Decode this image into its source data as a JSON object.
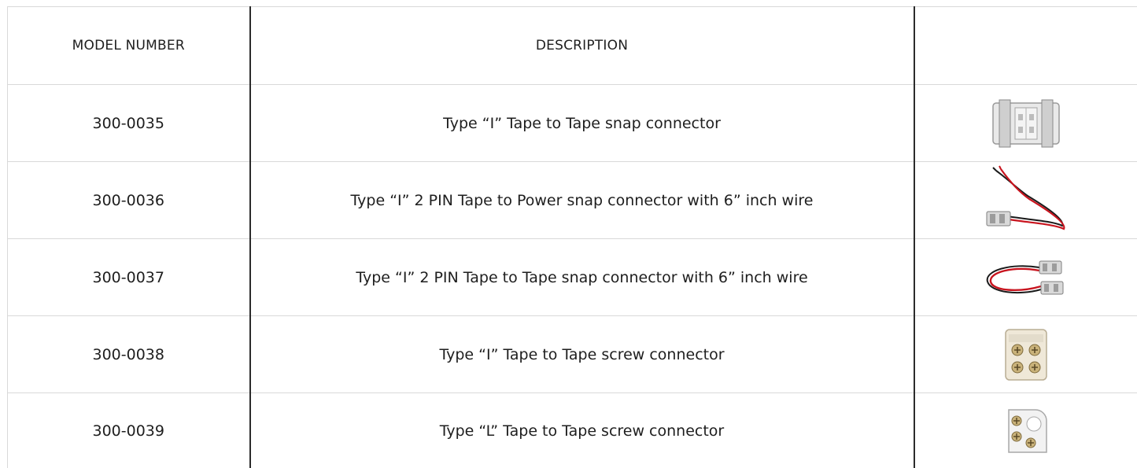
{
  "table": {
    "headers": {
      "model": "MODEL NUMBER",
      "description": "DESCRIPTION",
      "image": ""
    },
    "rows": [
      {
        "model": "300-0035",
        "description": "Type “I” Tape to Tape snap connector",
        "image_icon": "snap-connector-clear-icon"
      },
      {
        "model": "300-0036",
        "description": "Type “I” 2 PIN Tape to Power snap connector with 6” inch wire",
        "image_icon": "power-wire-connector-icon"
      },
      {
        "model": "300-0037",
        "description": "Type “I” 2 PIN Tape to Tape snap connector with 6” inch wire",
        "image_icon": "wire-loop-connector-icon"
      },
      {
        "model": "300-0038",
        "description": "Type “I” Tape to Tape screw connector",
        "image_icon": "screw-connector-i-icon"
      },
      {
        "model": "300-0039",
        "description": "Type “L” Tape to Tape screw connector",
        "image_icon": "screw-connector-l-icon"
      }
    ]
  },
  "colors": {
    "grid_light": "#d9d9d9",
    "grid_dark": "#2b2b2b",
    "wire_red": "#c8141e",
    "wire_black": "#1a1a1a",
    "connector_clear": "#dcdcdc"
  }
}
